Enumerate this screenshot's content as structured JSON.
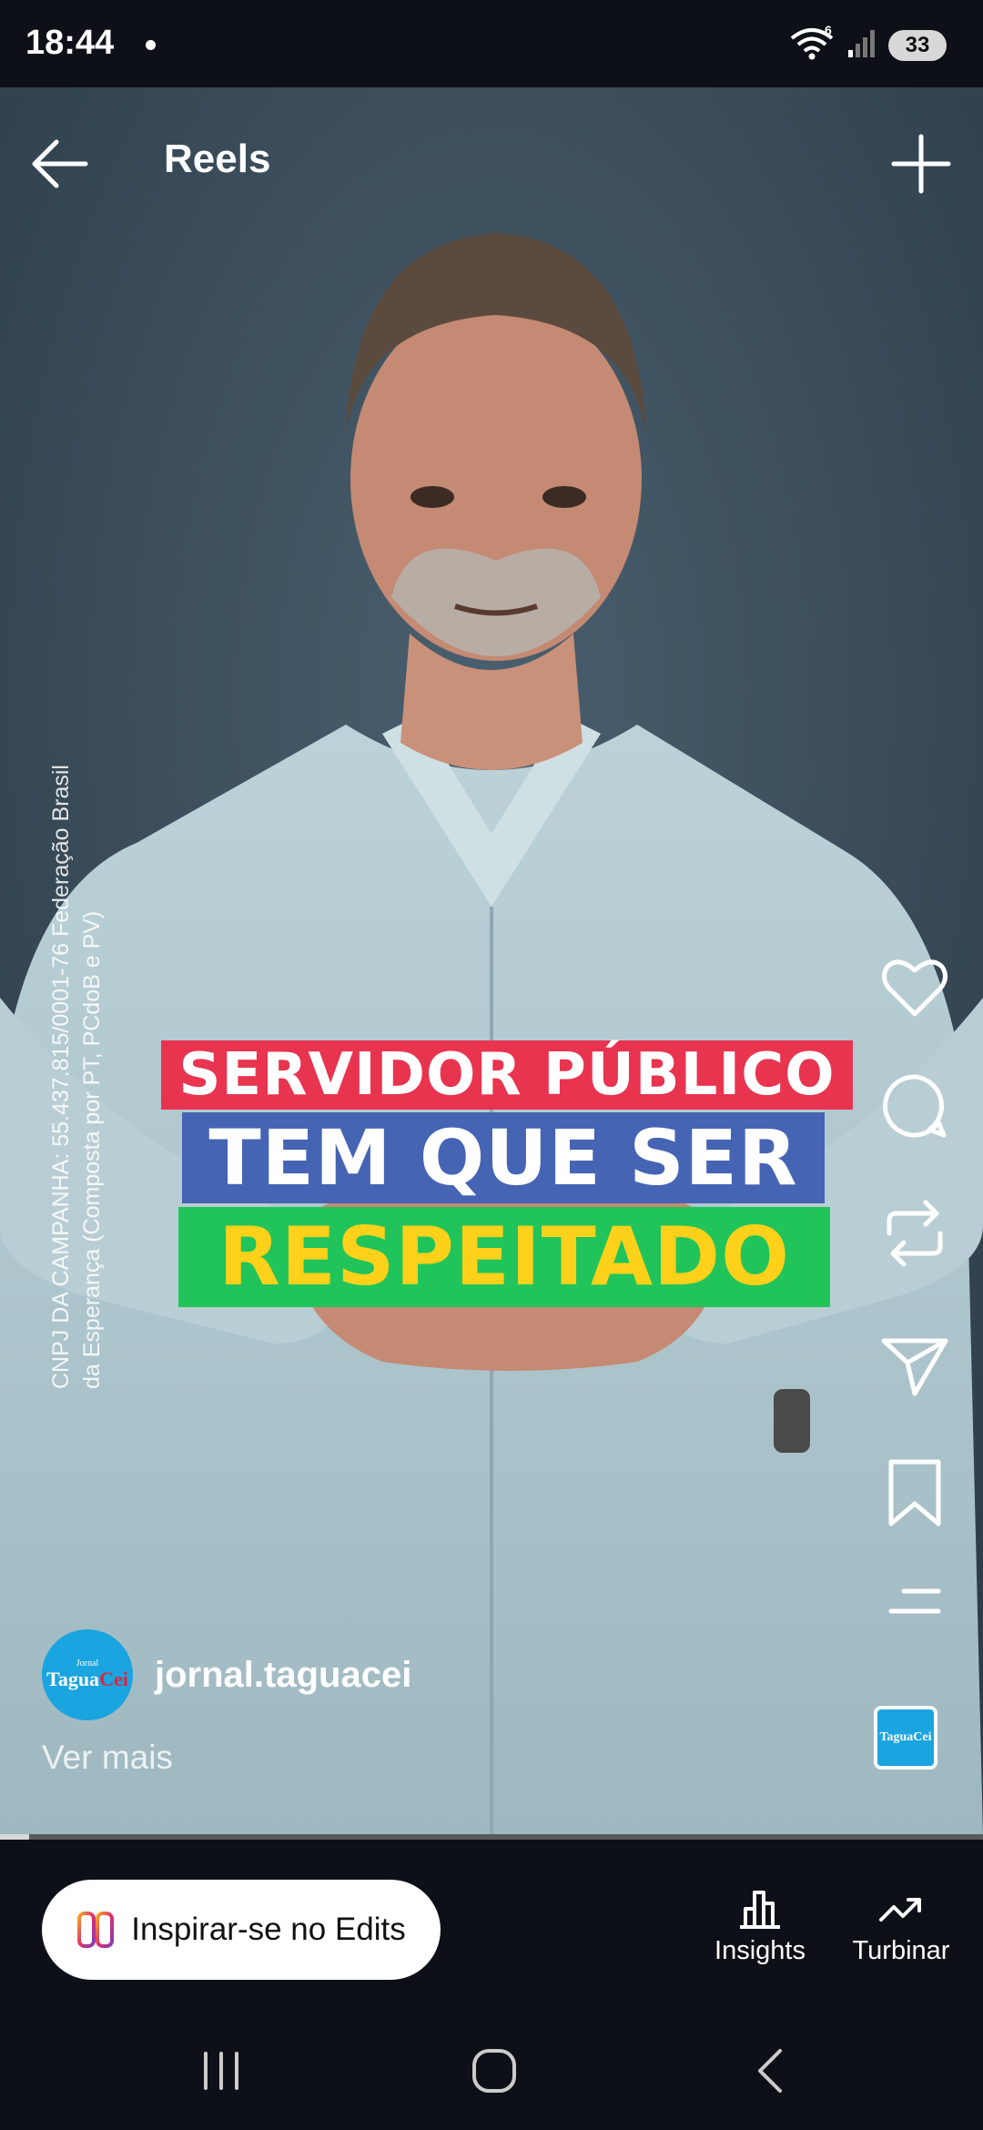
{
  "status_bar": {
    "time": "18:44",
    "network_label": "6",
    "battery": "33"
  },
  "top_bar": {
    "title": "Reels"
  },
  "video": {
    "overlay_vertical_line1": "CNPJ DA CAMPANHA: 55.437.815/0001-76 Federação Brasil",
    "overlay_vertical_line2": "da Esperança (Composta por PT, PCdoB e PV)",
    "caption_line1": "SERVIDOR PÚBLICO",
    "caption_line2": "TEM QUE SER",
    "caption_line3": "RESPEITADO",
    "caption_colors": {
      "line1_bg": "#e8344f",
      "line2_bg": "#4564b3",
      "line3_bg": "#20c45a",
      "line3_text": "#ffd11a"
    }
  },
  "side_actions": [
    "heart-icon",
    "comment-icon",
    "repost-icon",
    "share-icon",
    "bookmark-icon",
    "more-icon"
  ],
  "account": {
    "avatar_small": "Jornal",
    "avatar_main_part1": "Tagua",
    "avatar_main_part2": "Cei",
    "username": "jornal.taguacei",
    "more_label": "Ver mais",
    "audio_thumb_label": "TaguaCei"
  },
  "progress": {
    "fraction": 0.03
  },
  "bottom_bar": {
    "edits_label": "Inspirar-se no Edits",
    "insights_label": "Insights",
    "boost_label": "Turbinar"
  },
  "colors": {
    "background": "#0d1117",
    "avatar": "#1aa4e0"
  }
}
